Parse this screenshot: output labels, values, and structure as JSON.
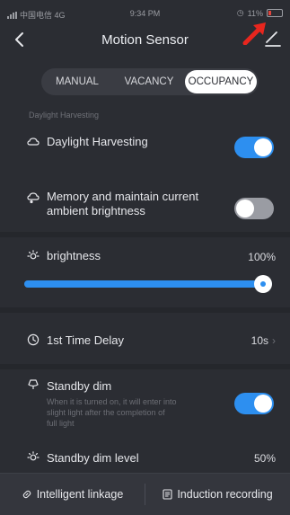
{
  "status_bar": {
    "carrier": "中国电信 4G",
    "time": "9:34 PM",
    "battery": "11%"
  },
  "header": {
    "title": "Motion Sensor"
  },
  "mode_tabs": [
    {
      "label": "MANUAL",
      "active": false
    },
    {
      "label": "VACANCY",
      "active": false
    },
    {
      "label": "OCCUPANCY",
      "active": true
    }
  ],
  "section_label": "Daylight Harvesting",
  "settings": {
    "daylight_harvesting": {
      "label": "Daylight Harvesting",
      "enabled": true
    },
    "memory": {
      "label_line1": "Memory and maintain current",
      "label_line2": "ambient brightness",
      "enabled": false
    },
    "brightness": {
      "label": "brightness",
      "value": "100%",
      "level": 1.0
    },
    "time_delay": {
      "label": "1st Time Delay",
      "value": "10s"
    },
    "standby_dim": {
      "label": "Standby dim",
      "description_line1": "When it is turned on, it will enter into",
      "description_line2": "slight light after the completion of",
      "description_line3": "full light",
      "enabled": true
    },
    "standby_dim_level": {
      "label": "Standby dim level",
      "value": "50%"
    }
  },
  "bottom_bar": {
    "intelligent_linkage": "Intelligent linkage",
    "induction_recording": "Induction recording"
  },
  "colors": {
    "accent": "#2d8ff0",
    "annotation_arrow": "#e8261e"
  }
}
